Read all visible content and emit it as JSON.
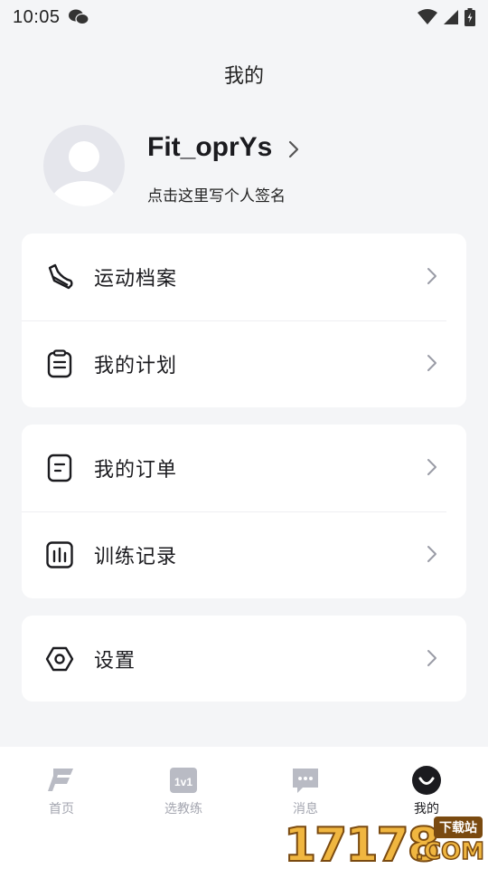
{
  "status_bar": {
    "time": "10:05"
  },
  "header": {
    "title": "我的"
  },
  "profile": {
    "username": "Fit_oprYs",
    "signature": "点击这里写个人签名"
  },
  "menu_groups": [
    {
      "items": [
        {
          "label": "运动档案",
          "icon": "sneaker-icon"
        },
        {
          "label": "我的计划",
          "icon": "clipboard-icon"
        }
      ]
    },
    {
      "items": [
        {
          "label": "我的订单",
          "icon": "document-icon"
        },
        {
          "label": "训练记录",
          "icon": "bar-chart-icon"
        }
      ]
    },
    {
      "items": [
        {
          "label": "设置",
          "icon": "hexagon-settings-icon"
        }
      ]
    }
  ],
  "tabbar": {
    "items": [
      {
        "label": "首页",
        "icon": "f-logo-icon",
        "active": false
      },
      {
        "label": "选教练",
        "icon": "1v1-icon",
        "active": false
      },
      {
        "label": "消息",
        "icon": "chat-bubble-icon",
        "active": false
      },
      {
        "label": "我的",
        "icon": "smile-profile-icon",
        "active": true
      }
    ]
  },
  "watermark": {
    "digits": "17178",
    "badge": "下载站",
    "suffix": ".COM"
  },
  "colors": {
    "background": "#f4f5f7",
    "card": "#ffffff",
    "text": "#1b1b1f",
    "muted": "#a4a6b0",
    "watermark": "#f0b640"
  }
}
